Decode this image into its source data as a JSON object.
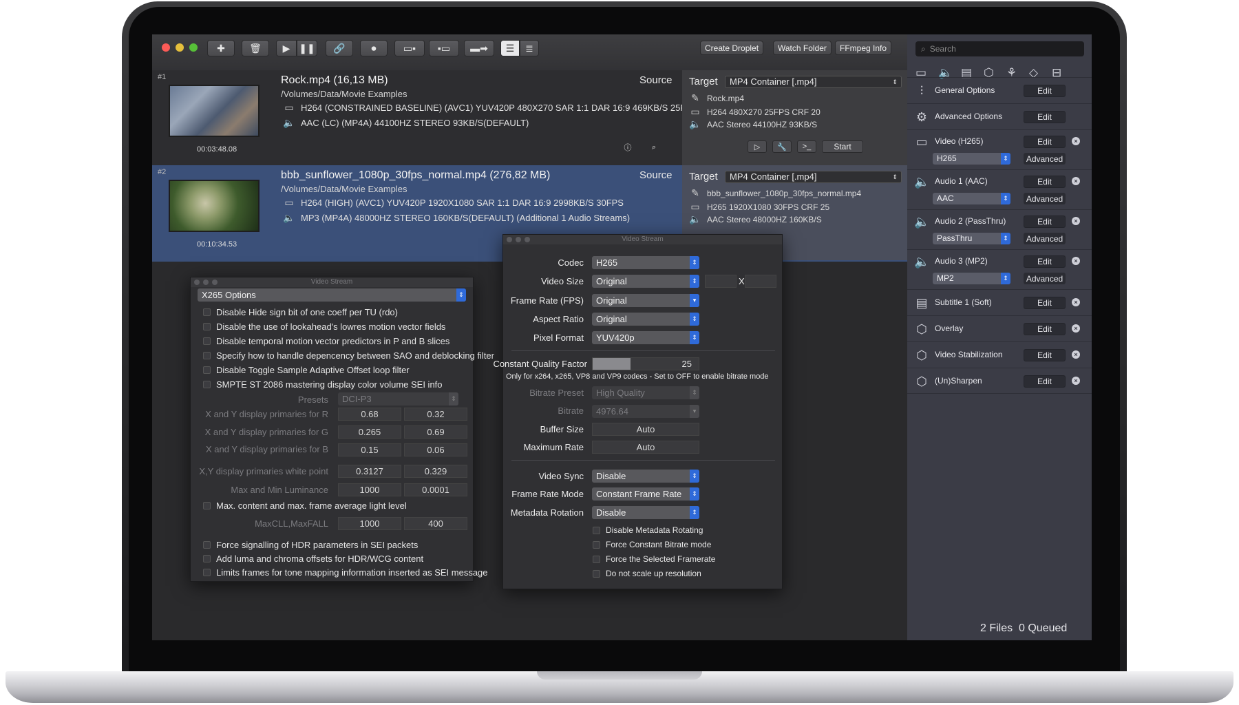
{
  "toolbar": {
    "create_droplet": "Create Droplet",
    "watch_folder": "Watch Folder",
    "ffmpeg_info": "FFmpeg Info"
  },
  "files": [
    {
      "num": "#1",
      "name": "Rock.mp4  (16,13 MB)",
      "path": "/Volumes/Data/Movie Examples",
      "video": "H264 (CONSTRAINED BASELINE) (AVC1)  YUV420P 480X270 SAR 1:1 DAR 16:9 469KB/S 25F...",
      "audio": "AAC (LC) (MP4A) 44100HZ STEREO 93KB/S(DEFAULT)",
      "duration": "00:03:48.08",
      "source_label": "Source",
      "target_label": "Target",
      "container": "MP4 Container [.mp4]",
      "target_name": "Rock.mp4",
      "target_video": "H264 480X270 25FPS CRF 20",
      "target_audio": "AAC Stereo 44100HZ 93KB/S",
      "start_label": "Start"
    },
    {
      "num": "#2",
      "name": "bbb_sunflower_1080p_30fps_normal.mp4  (276,82 MB)",
      "path": "/Volumes/Data/Movie Examples",
      "video": "H264 (HIGH) (AVC1)  YUV420P 1920X1080 SAR 1:1 DAR 16:9 2998KB/S 30FPS",
      "audio": "MP3 (MP4A) 48000HZ STEREO 160KB/S(DEFAULT) (Additional 1 Audio Streams)",
      "duration": "00:10:34.53",
      "source_label": "Source",
      "target_label": "Target",
      "container": "MP4 Container [.mp4]",
      "target_name": "bbb_sunflower_1080p_30fps_normal.mp4",
      "target_video": "H265 1920X1080 30FPS CRF 25",
      "target_audio": "AAC Stereo 48000HZ 160KB/S"
    }
  ],
  "right_panel": {
    "search_placeholder": "Search",
    "edit_label": "Edit",
    "advanced_label": "Advanced",
    "items": [
      {
        "label": "General Options",
        "icon": "sliders-icon"
      },
      {
        "label": "Advanced Options",
        "icon": "gear-icon"
      },
      {
        "label": "Video (H265)",
        "icon": "video-icon",
        "codec": "H265"
      },
      {
        "label": "Audio 1 (AAC)",
        "icon": "speaker-icon",
        "codec": "AAC"
      },
      {
        "label": "Audio 2 (PassThru)",
        "icon": "speaker-icon",
        "codec": "PassThru"
      },
      {
        "label": "Audio 3 (MP2)",
        "icon": "speaker-icon",
        "codec": "MP2"
      },
      {
        "label": "Subtitle 1 (Soft)",
        "icon": "subtitle-icon"
      },
      {
        "label": "Overlay",
        "icon": "cube-icon"
      },
      {
        "label": "Video Stabilization",
        "icon": "cube-icon"
      },
      {
        "label": "(Un)Sharpen",
        "icon": "cube-icon"
      }
    ],
    "status_files": "2 Files",
    "status_queued": "0 Queued"
  },
  "x265_dialog": {
    "title": "Video Stream",
    "header": "X265 Options",
    "checks_top": [
      "Disable Hide sign bit of one coeff per TU (rdo)",
      "Disable the use of lookahead's lowres motion vector fields",
      "Disable temporal motion vector predictors in P and B slices",
      "Specify how to handle depencency between SAO and deblocking filter",
      "Disable Toggle Sample Adaptive Offset loop filter",
      "SMPTE ST 2086 mastering display color volume SEI info"
    ],
    "presets_label": "Presets",
    "presets_value": "DCI-P3",
    "pairs": [
      {
        "label": "X and Y display primaries for R",
        "a": "0.68",
        "b": "0.32"
      },
      {
        "label": "X and Y display primaries for G",
        "a": "0.265",
        "b": "0.69"
      },
      {
        "label": "X and Y display primaries for B",
        "a": "0.15",
        "b": "0.06"
      },
      {
        "label": "X,Y display primaries white point",
        "a": "0.3127",
        "b": "0.329"
      },
      {
        "label": "Max and Min Luminance",
        "a": "1000",
        "b": "0.0001"
      }
    ],
    "maxcll_check": "Max. content and max. frame average light level",
    "maxcll_label": "MaxCLL,MaxFALL",
    "maxcll_a": "1000",
    "maxcll_b": "400",
    "checks_bottom": [
      "Force signalling of HDR parameters in SEI packets",
      "Add luma and chroma offsets for HDR/WCG content",
      "Limits frames for tone mapping information inserted as SEI message"
    ]
  },
  "video_dialog": {
    "title": "Video Stream",
    "codec_label": "Codec",
    "codec": "H265",
    "size_label": "Video Size",
    "size": "Original",
    "size_x": "X",
    "fps_label": "Frame Rate (FPS)",
    "fps": "Original",
    "aspect_label": "Aspect Ratio",
    "aspect": "Original",
    "pixfmt_label": "Pixel Format",
    "pixfmt": "YUV420p",
    "cqf_label": "Constant Quality Factor",
    "cqf_value": "25",
    "cqf_level": 0.36,
    "cqf_note": "Only for x264, x265, VP8 and VP9 codecs  -  Set to OFF to enable bitrate mode",
    "bitrate_preset_label": "Bitrate Preset",
    "bitrate_preset": "High Quality",
    "bitrate_label": "Bitrate",
    "bitrate": "4976.64",
    "buffer_label": "Buffer Size",
    "buffer": "Auto",
    "maxrate_label": "Maximum Rate",
    "maxrate": "Auto",
    "sync_label": "Video Sync",
    "sync": "Disable",
    "frmode_label": "Frame Rate Mode",
    "frmode": "Constant Frame Rate",
    "rotation_label": "Metadata Rotation",
    "rotation": "Disable",
    "checks": [
      "Disable Metadata Rotating",
      "Force Constant Bitrate mode",
      "Force the Selected Framerate",
      "Do not scale up resolution"
    ]
  }
}
